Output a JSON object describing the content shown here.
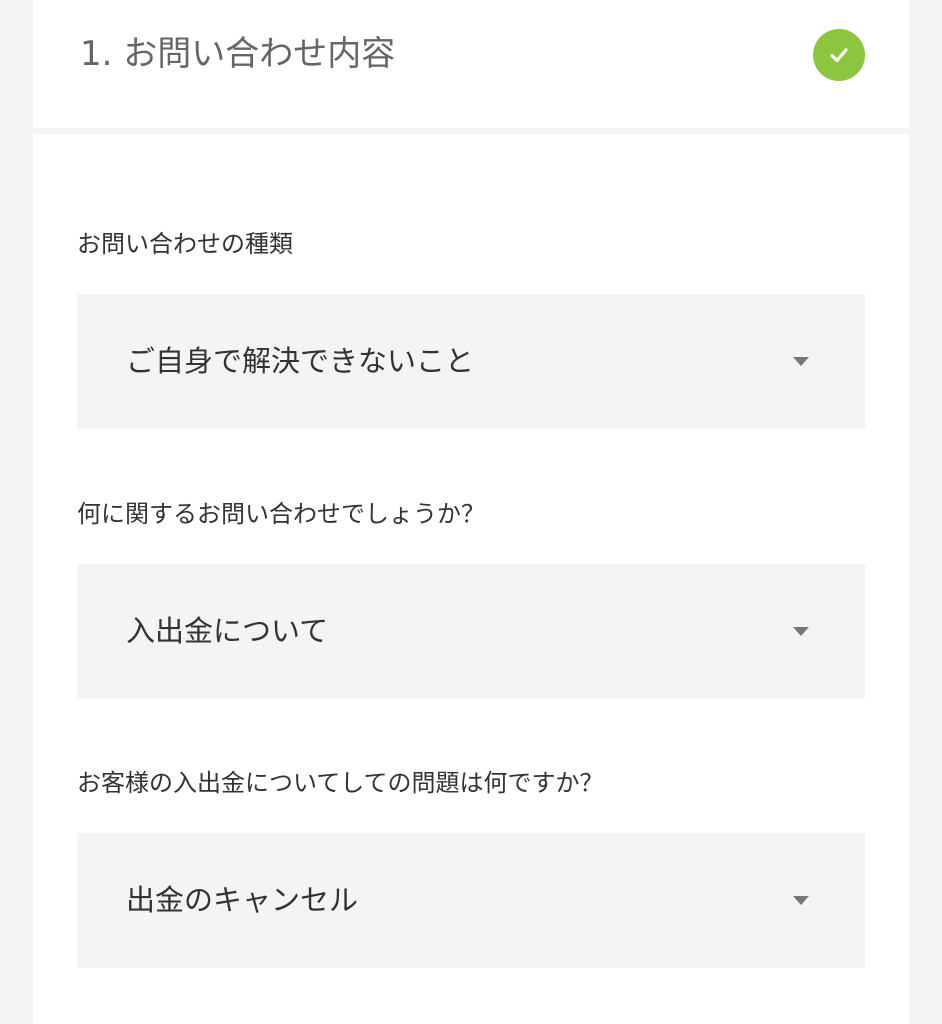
{
  "header": {
    "title": "1. お問い合わせ内容",
    "status_icon": "check-circle-icon",
    "status_color": "#8cc63f"
  },
  "form": {
    "fields": [
      {
        "label": "お問い合わせの種類",
        "value": "ご自身で解決できないこと",
        "icon": "caret-down-icon"
      },
      {
        "label": "何に関するお問い合わせでしょうか？",
        "value": "入出金について",
        "icon": "caret-down-icon"
      },
      {
        "label": "お客様の入出金についてしての問題は何ですか？",
        "value": "出金のキャンセル",
        "icon": "caret-down-icon"
      }
    ]
  }
}
